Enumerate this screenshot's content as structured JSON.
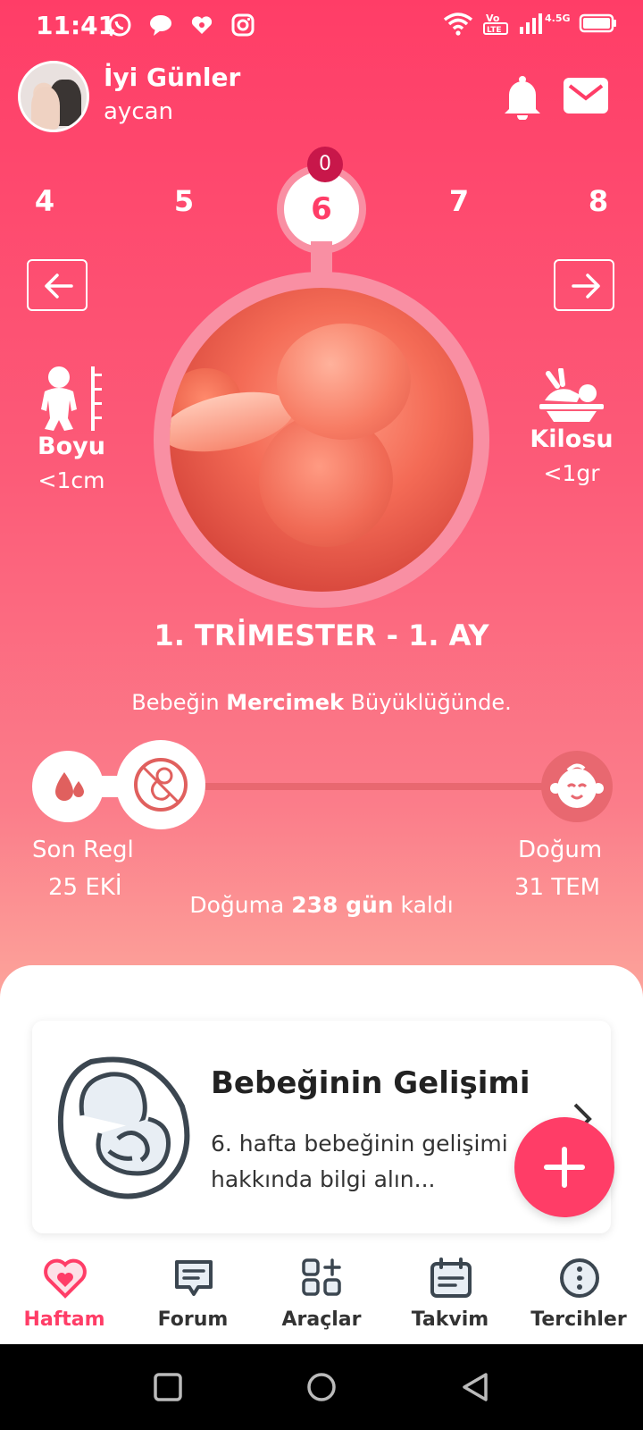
{
  "status_bar": {
    "time": "11:41",
    "network": "4.5G",
    "volte": "Vo LTE"
  },
  "header": {
    "greeting": "İyi Günler",
    "username": "aycan"
  },
  "weeks": {
    "items": [
      "4",
      "5",
      "6",
      "7",
      "8"
    ],
    "current": "6",
    "badge": "0"
  },
  "baby_stats": {
    "length_label": "Boyu",
    "length_value": "<1cm",
    "weight_label": "Kilosu",
    "weight_value": "<1gr"
  },
  "trimester": "1. TRİMESTER - 1. AY",
  "size_compare": {
    "prefix": "Bebeğin ",
    "fruit": "Mercimek",
    "suffix": " Büyüklüğünde."
  },
  "timeline": {
    "start_label": "Son Regl",
    "start_date": "25 EKİ",
    "end_label": "Doğum",
    "end_date": "31 TEM",
    "remaining_prefix": "Doğuma ",
    "remaining_value": "238 gün",
    "remaining_suffix": " kaldı"
  },
  "card": {
    "title": "Bebeğinin Gelişimi",
    "description": "6. hafta bebeğinin gelişimi hakkında bilgi alın..."
  },
  "bottom_nav": [
    {
      "label": "Haftam",
      "icon": "heart-icon",
      "active": true
    },
    {
      "label": "Forum",
      "icon": "chat-icon",
      "active": false
    },
    {
      "label": "Araçlar",
      "icon": "grid-plus-icon",
      "active": false
    },
    {
      "label": "Takvim",
      "icon": "calendar-icon",
      "active": false
    },
    {
      "label": "Tercihler",
      "icon": "more-icon",
      "active": false
    }
  ],
  "colors": {
    "accent": "#ff3d67",
    "badge": "#c8174a",
    "ring": "#f98fa3",
    "timeline": "#e86870"
  }
}
